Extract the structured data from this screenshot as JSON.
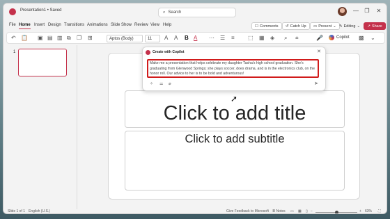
{
  "titlebar": {
    "document_title": "Presentation1 • Saved",
    "search_placeholder": "Search",
    "window_controls": [
      "—",
      "❐",
      "✕"
    ]
  },
  "menu": {
    "items": [
      "File",
      "Home",
      "Insert",
      "Design",
      "Transitions",
      "Animations",
      "Slide Show",
      "Review",
      "View",
      "Help"
    ],
    "active": "Home",
    "comments_label": "Comments",
    "catchup_label": "Catch Up",
    "present_label": "Present",
    "editing_label": "Editing",
    "share_label": "Share"
  },
  "toolbar": {
    "font_name": "Aptos (Body)",
    "font_size": "11",
    "copilot_label": "Copilot"
  },
  "slides_pane": {
    "slide_number": "1"
  },
  "slide": {
    "title_placeholder": "Click to add title",
    "subtitle_placeholder": "Click to add subtitle"
  },
  "copilot_card": {
    "title": "Create with Copilot",
    "prompt": "Make me a presentation that helps celebrate my daughter Tasha's high school graduation. She's graduating from Glenwood Springs; she plays soccer, does drama, and is in the electronics club, on the honor roll. Our advice to her is to be bold and adventurous!"
  },
  "statusbar": {
    "slide_info": "Slide 1 of 1",
    "language": "English (U.S.)",
    "feedback": "Give Feedback to Microsoft",
    "notes_label": "Notes",
    "zoom": "63%"
  },
  "colors": {
    "accent": "#c4314b",
    "highlight": "#d11b1b"
  }
}
